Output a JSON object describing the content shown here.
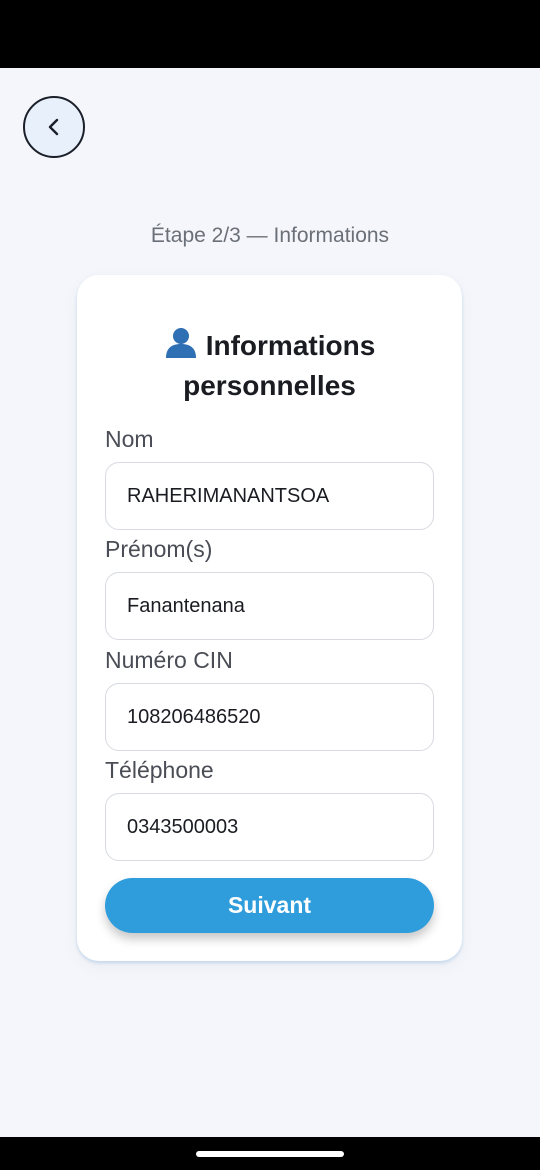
{
  "header": {
    "back_icon": "chevron-left-icon",
    "step_label": "Étape 2/3 — Informations"
  },
  "card": {
    "title_icon": "person-icon",
    "title_line1": "Informations",
    "title_line2": "personnelles"
  },
  "form": {
    "nom": {
      "label": "Nom",
      "value": "RAHERIMANANTSOA"
    },
    "prenom": {
      "label": "Prénom(s)",
      "value": "Fanantenana"
    },
    "cin": {
      "label": "Numéro CIN",
      "value": "108206486520"
    },
    "telephone": {
      "label": "Téléphone",
      "value": "0343500003"
    }
  },
  "actions": {
    "next_label": "Suivant"
  },
  "colors": {
    "accent": "#2f9ddc",
    "background": "#f4f6fb",
    "card": "#ffffff",
    "title": "#1a1c22",
    "label": "#4a4d55"
  }
}
